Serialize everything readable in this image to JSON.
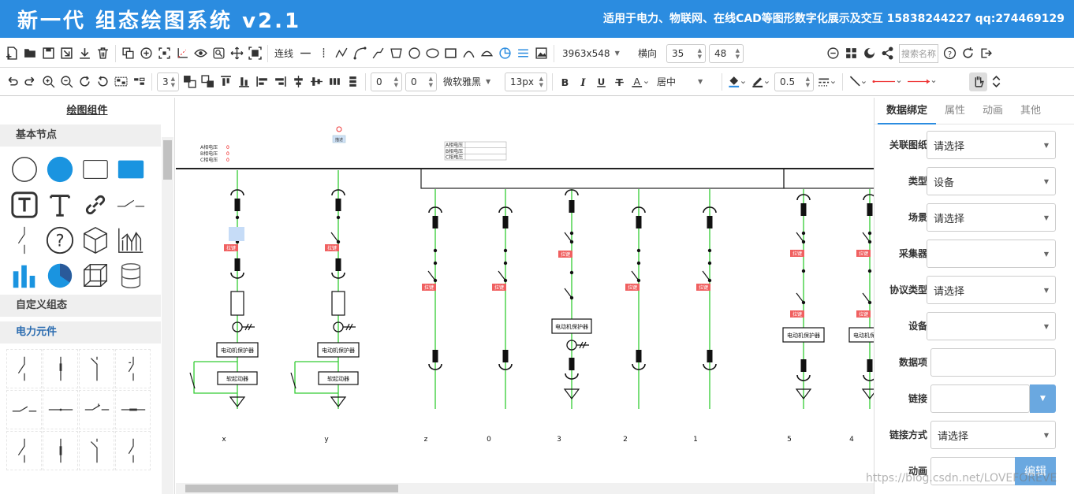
{
  "header": {
    "title": "新一代 组态绘图系统 v2.1",
    "slogan": "适用于电力、物联网、在线CAD等图形数字化展示及交互  15838244227 qq:274469129"
  },
  "toolbar1": {
    "connect_label": "连线",
    "canvas_size": "3963x548",
    "orientation": "横向",
    "grid_size": "35",
    "zoom_value": "48",
    "search_placeholder": "搜索名称"
  },
  "toolbar2": {
    "layer_value": "3",
    "offset_x": "0",
    "offset_y": "0",
    "font_family": "微软雅黑",
    "font_size": "13px",
    "align_label": "居中",
    "line_width": "0.5"
  },
  "left_panel": {
    "title": "绘图组件",
    "section_basic": "基本节点",
    "section_custom": "自定义组态",
    "section_power": "电力元件"
  },
  "right_panel": {
    "tabs": [
      "数据绑定",
      "属性",
      "动画",
      "其他"
    ],
    "fields": [
      {
        "label": "关联图纸",
        "value": "请选择"
      },
      {
        "label": "类型",
        "value": "设备"
      },
      {
        "label": "场景",
        "value": "请选择"
      },
      {
        "label": "采集器",
        "value": ""
      },
      {
        "label": "协议类型",
        "value": "请选择"
      },
      {
        "label": "设备",
        "value": ""
      },
      {
        "label": "数据项",
        "value": ""
      },
      {
        "label": "链接",
        "value": ""
      },
      {
        "label": "链接方式",
        "value": "请选择"
      },
      {
        "label": "动画",
        "value": ""
      }
    ],
    "edit_button": "编辑"
  },
  "diagram": {
    "phase_labels": [
      "A相电压",
      "B相电压",
      "C相电压"
    ],
    "phase_values": [
      "0",
      "0",
      "0"
    ],
    "button_label": "描述",
    "protector_label": "电动机保护器",
    "soft_starter_label": "软起动器",
    "tag_label": "拉键",
    "bay_labels": [
      "x",
      "y",
      "z",
      "0",
      "3",
      "2",
      "1",
      "5",
      "4"
    ]
  },
  "watermark": "https://blog.csdn.net/LOVEFOREVE",
  "colors": {
    "header_bg": "#2b8ce0",
    "accent": "#2b8ce0",
    "line_green": "#33cc33",
    "tag_red": "#f06060"
  }
}
